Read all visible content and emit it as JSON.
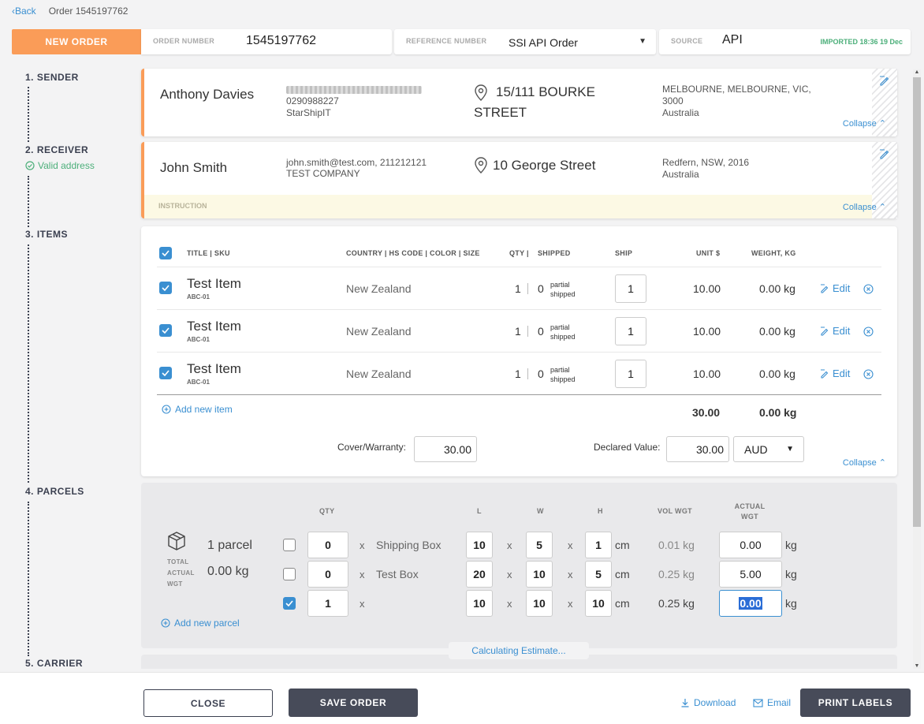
{
  "nav": {
    "back": "‹Back",
    "order": "Order 1545197762"
  },
  "header": {
    "new_order": "NEW ORDER",
    "order_number_label": "ORDER NUMBER",
    "order_number": "1545197762",
    "reference_label": "REFERENCE NUMBER",
    "reference_value": "SSI API Order",
    "source_label": "SOURCE",
    "source_value": "API",
    "imported": "IMPORTED 18:36 19 Dec"
  },
  "steps": {
    "sender": "1. SENDER",
    "receiver": "2. RECEIVER",
    "valid_address": "Valid address",
    "items": "3. ITEMS",
    "parcels": "4. PARCELS",
    "carrier": "5. CARRIER"
  },
  "sender": {
    "name": "Anthony Davies",
    "phone": "0290988227",
    "company": "StarShipIT",
    "street": "15/111 BOURKE STREET",
    "city": "MELBOURNE, MELBOURNE, VIC,",
    "postcode": "3000",
    "country": "Australia",
    "collapse": "Collapse ⌃"
  },
  "receiver": {
    "name": "John Smith",
    "contact": "john.smith@test.com, 211212121",
    "company": "TEST COMPANY",
    "street": "10 George Street",
    "city": "Redfern, NSW, 2016",
    "country": "Australia",
    "instruction": "INSTRUCTION",
    "collapse": "Collapse ⌃"
  },
  "items": {
    "headers": {
      "title": "TITLE | SKU",
      "country": "COUNTRY | HS CODE | COLOR | SIZE",
      "qty": "QTY |",
      "shipped": "SHIPPED",
      "ship": "SHIP",
      "unit": "UNIT $",
      "weight": "WEIGHT, KG"
    },
    "rows": [
      {
        "title": "Test Item",
        "sku": "ABC-01",
        "country": "New Zealand",
        "qty": "1",
        "shipped": "0",
        "partial1": "partial",
        "partial2": "shipped",
        "ship": "1",
        "unit": "10.00",
        "weight": "0.00 kg",
        "edit": "Edit"
      },
      {
        "title": "Test Item",
        "sku": "ABC-01",
        "country": "New Zealand",
        "qty": "1",
        "shipped": "0",
        "partial1": "partial",
        "partial2": "shipped",
        "ship": "1",
        "unit": "10.00",
        "weight": "0.00 kg",
        "edit": "Edit"
      },
      {
        "title": "Test Item",
        "sku": "ABC-01",
        "country": "New Zealand",
        "qty": "1",
        "shipped": "0",
        "partial1": "partial",
        "partial2": "shipped",
        "ship": "1",
        "unit": "10.00",
        "weight": "0.00 kg",
        "edit": "Edit"
      }
    ],
    "add_new": "Add new item",
    "total_unit": "30.00",
    "total_weight": "0.00 kg",
    "cover_label": "Cover/Warranty:",
    "cover_value": "30.00",
    "declared_label": "Declared Value:",
    "declared_value": "30.00",
    "currency": "AUD",
    "collapse": "Collapse ⌃"
  },
  "parcels": {
    "headers": {
      "qty": "QTY",
      "l": "L",
      "w": "W",
      "h": "H",
      "vol": "VOL WGT",
      "actual1": "ACTUAL",
      "actual2": "WGT"
    },
    "count": "1 parcel",
    "total_weight": "0.00 kg",
    "total_label1": "TOTAL",
    "total_label2": "ACTUAL",
    "total_label3": "WGT",
    "rows": [
      {
        "qty": "0",
        "name": "Shipping Box",
        "l": "10",
        "w": "5",
        "h": "1",
        "unit": "cm",
        "vol": "0.01 kg",
        "actual": "0.00",
        "kg": "kg"
      },
      {
        "qty": "0",
        "name": "Test Box",
        "l": "20",
        "w": "10",
        "h": "5",
        "unit": "cm",
        "vol": "0.25 kg",
        "actual": "5.00",
        "kg": "kg"
      },
      {
        "qty": "1",
        "name": "",
        "l": "10",
        "w": "10",
        "h": "10",
        "unit": "cm",
        "vol": "0.25 kg",
        "actual": "0.00",
        "kg": "kg"
      }
    ],
    "times": "x",
    "add_new": "Add new parcel",
    "calculating": "Calculating Estimate..."
  },
  "footer": {
    "close": "CLOSE",
    "save": "SAVE ORDER",
    "download": "Download",
    "email": "Email",
    "print": "PRINT LABELS"
  }
}
